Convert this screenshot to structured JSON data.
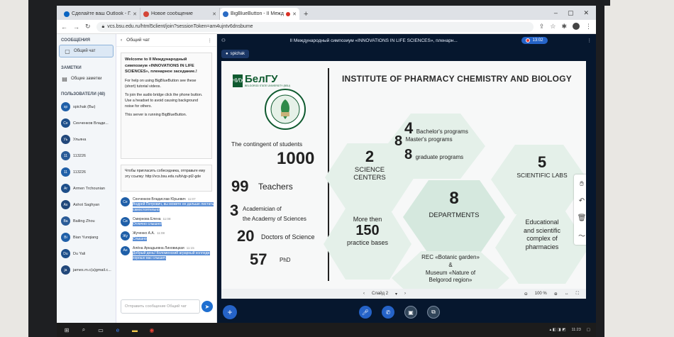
{
  "browser": {
    "tabs": [
      {
        "title": "Сделайте ваш Outlook - Глобально..."
      },
      {
        "title": "Новое сообщение"
      },
      {
        "title": "BigBlueButton - II Международ..."
      }
    ],
    "new_tab": "+",
    "url": "vcs.bsu.edu.ru/html5client/join?sessionToken=am4ujntv6dnsbume"
  },
  "sidebar": {
    "messages_title": "СООБЩЕНИЯ",
    "public_chat": "Общий чат",
    "notes_title": "ЗАМЕТКИ",
    "shared_notes": "Общие заметки",
    "users_title": "ПОЛЬЗОВАТЕЛИ (48)",
    "users": [
      {
        "initials": "sp",
        "name": "spichak (Вы)"
      },
      {
        "initials": "Се",
        "name": "Сенченков Влади..."
      },
      {
        "initials": "Уь",
        "name": "Ульяна"
      },
      {
        "initials": "11",
        "name": "113226"
      },
      {
        "initials": "11",
        "name": "113226"
      },
      {
        "initials": "Ar",
        "name": "Armen Trchounian"
      },
      {
        "initials": "As",
        "name": "Ashot Saghyan"
      },
      {
        "initials": "Ba",
        "name": "Bailing Zhou"
      },
      {
        "initials": "Bi",
        "name": "Bian Yunqiang"
      },
      {
        "initials": "Du",
        "name": "Du Yali"
      },
      {
        "initials": "ja",
        "name": "james.m.c(a)gmail.c..."
      }
    ]
  },
  "chat": {
    "header": "Общий чат",
    "welcome_title": "Welcome to II Международный симпозиум «INNOVATIONS IN LIFE SCIENCES», пленарное заседание.!",
    "welcome_help": "For help on using BigBlueButton see these (short) tutorial videos.",
    "welcome_audio": "To join the audio bridge click the phone button. Use a headset to avoid causing background noise for others.",
    "welcome_server": "This server is running BigBlueButton.",
    "invite_text": "Чтобы пригласить собеседника, отправьте ему эту ссылку: http://vcs.bsu.edu.ru/b/vjp-pt2-gde",
    "messages": [
      {
        "initials": "Се",
        "name": "Сенченков Владислав Юрьевич",
        "time": "11:07",
        "text": "Андрей Петрович, вы можете ее дальше листать самостоятельно"
      },
      {
        "initials": "Си",
        "name": "Смирнова Елена",
        "time": "11:08",
        "text": "Отлично слышно!"
      },
      {
        "initials": "Жу",
        "name": "Жученко А.А.",
        "time": "11:08",
        "text": "Слышно"
      },
      {
        "initials": "Ан",
        "name": "Алёна Аркадьевна Линовицкая",
        "time": "11:15",
        "text": "Добрый день! Коломенский аграрный колледж хорошо вас слышит."
      }
    ],
    "input_placeholder": "Отправить сообщение Общий чат"
  },
  "stage": {
    "title": "II Международный симпозиум «INNOVATIONS IN LIFE SCIENCES», пленарн...",
    "recording_time": "13:02",
    "presenter": "spichak",
    "slide_label": "Слайд 2",
    "zoom": "100 %"
  },
  "slide": {
    "header": "INSTITUTE OF PHARMACY CHEMISTRY AND BIOLOGY",
    "logo_text": "БелГУ",
    "logo_sub": "BELGOROD STATE UNIVERSITY (BSU)",
    "contingent_label": "The contingent of students",
    "contingent_value": "1000",
    "teachers_value": "99",
    "teachers_label": "Teachers",
    "academician_value": "3",
    "academician_label1": "Academician of",
    "academician_label2": "the Academy of Sciences",
    "doctors_value": "20",
    "doctors_label": "Doctors of Science",
    "phd_value": "57",
    "phd_label": "PhD",
    "programs": {
      "bachelor_value": "4",
      "bachelor_label": "Bachelor's programs",
      "master_value": "8",
      "master_label": "Master's programs",
      "graduate_value": "8",
      "graduate_label": "graduate programs"
    },
    "science_value": "2",
    "science_label1": "SCIENCE",
    "science_label2": "CENTERS",
    "labs_value": "5",
    "labs_label": "SCIENTIFIC LABS",
    "dept_value": "8",
    "dept_label": "DEPARTMENTS",
    "practice_more": "More then",
    "practice_value": "150",
    "practice_label": "practice bases",
    "complex_label1": "Educational",
    "complex_label2": "and scientific",
    "complex_label3": "complex of",
    "complex_label4": "pharmacies",
    "rec_line1": "REC «Botanic garden»",
    "rec_line2": "&",
    "rec_line3": "Museum «Nature of",
    "rec_line4": "Belgorod region»"
  },
  "taskbar": {
    "time": "11:23"
  }
}
